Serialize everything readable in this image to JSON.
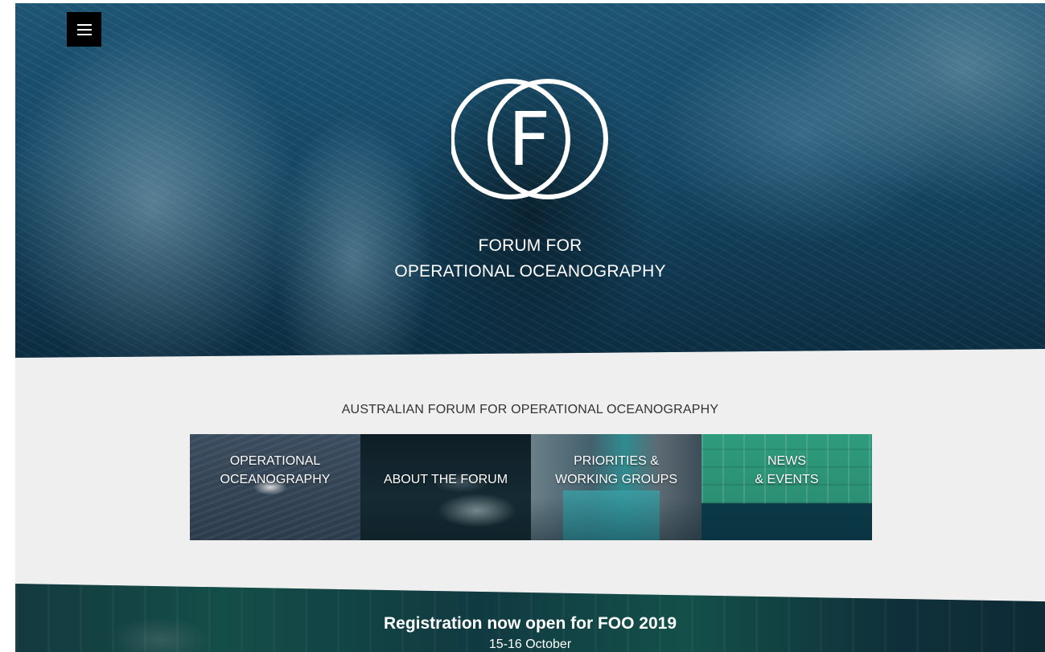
{
  "header": {
    "menu_icon": "hamburger-menu-icon",
    "logo_letter": "F",
    "title_line1": "FORUM FOR",
    "title_line2": "OPERATIONAL OCEANOGRAPHY"
  },
  "main": {
    "section_title": "AUSTRALIAN FORUM FOR OPERATIONAL OCEANOGRAPHY",
    "tiles": [
      {
        "line1": "OPERATIONAL",
        "line2": "OCEANOGRAPHY"
      },
      {
        "line1": "ABOUT THE FORUM",
        "line2": ""
      },
      {
        "line1": "PRIORITIES &",
        "line2": "WORKING GROUPS"
      },
      {
        "line1": "NEWS",
        "line2": "& EVENTS"
      }
    ]
  },
  "banner": {
    "title": "Registration now open for FOO 2019",
    "subtitle": "15-16 October"
  },
  "colors": {
    "hero_blue": "#1f5c7c",
    "page_background": "#efefef",
    "menu_button": "#000000",
    "banner_teal": "#1d6a5d"
  }
}
